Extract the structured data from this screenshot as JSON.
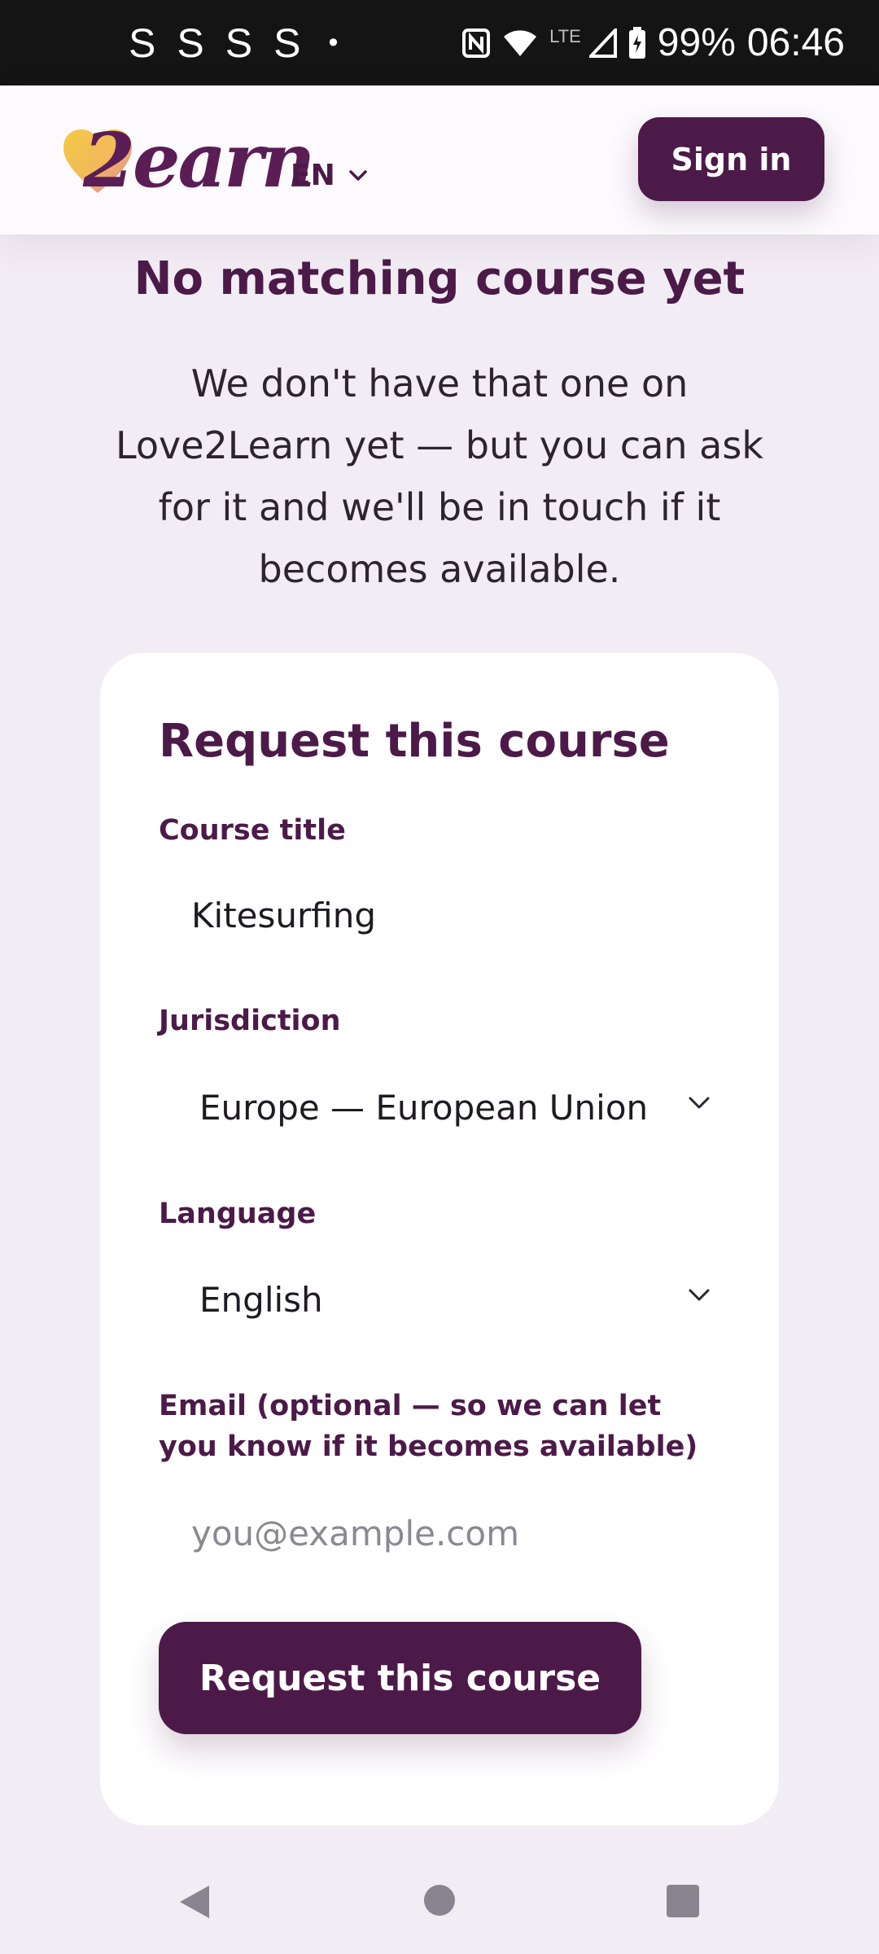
{
  "status_bar": {
    "notifications": [
      "S",
      "S",
      "S",
      "S"
    ],
    "dot": "•",
    "network": "LTE",
    "battery": "99%",
    "time": "06:46"
  },
  "header": {
    "logo_text": "2earn",
    "language": "EN",
    "sign_in_label": "Sign in"
  },
  "main": {
    "heading": "No matching course yet",
    "intro": "We don't have that one on Love2Learn yet — but you can ask for it and we'll be in touch if it becomes available."
  },
  "form": {
    "title": "Request this course",
    "course_title_label": "Course title",
    "course_title_value": "Kitesurfing",
    "jurisdiction_label": "Jurisdiction",
    "jurisdiction_value": "Europe — European Union (g",
    "language_label": "Language",
    "language_value": "English",
    "email_label": "Email (optional — so we can let you know if it becomes available)",
    "email_placeholder": "you@example.com",
    "submit_label": "Request this course"
  },
  "colors": {
    "brand": "#4c1a48",
    "background": "#f2ecf4",
    "card": "#ffffff",
    "status_bar": "#141414"
  },
  "icons": {
    "logo": "heart-icon",
    "language_chevron": "chevron-down-icon",
    "select_chevron": "chevron-down-icon",
    "nav_back": "back-triangle-icon",
    "nav_home": "home-circle-icon",
    "nav_recents": "recents-square-icon"
  }
}
